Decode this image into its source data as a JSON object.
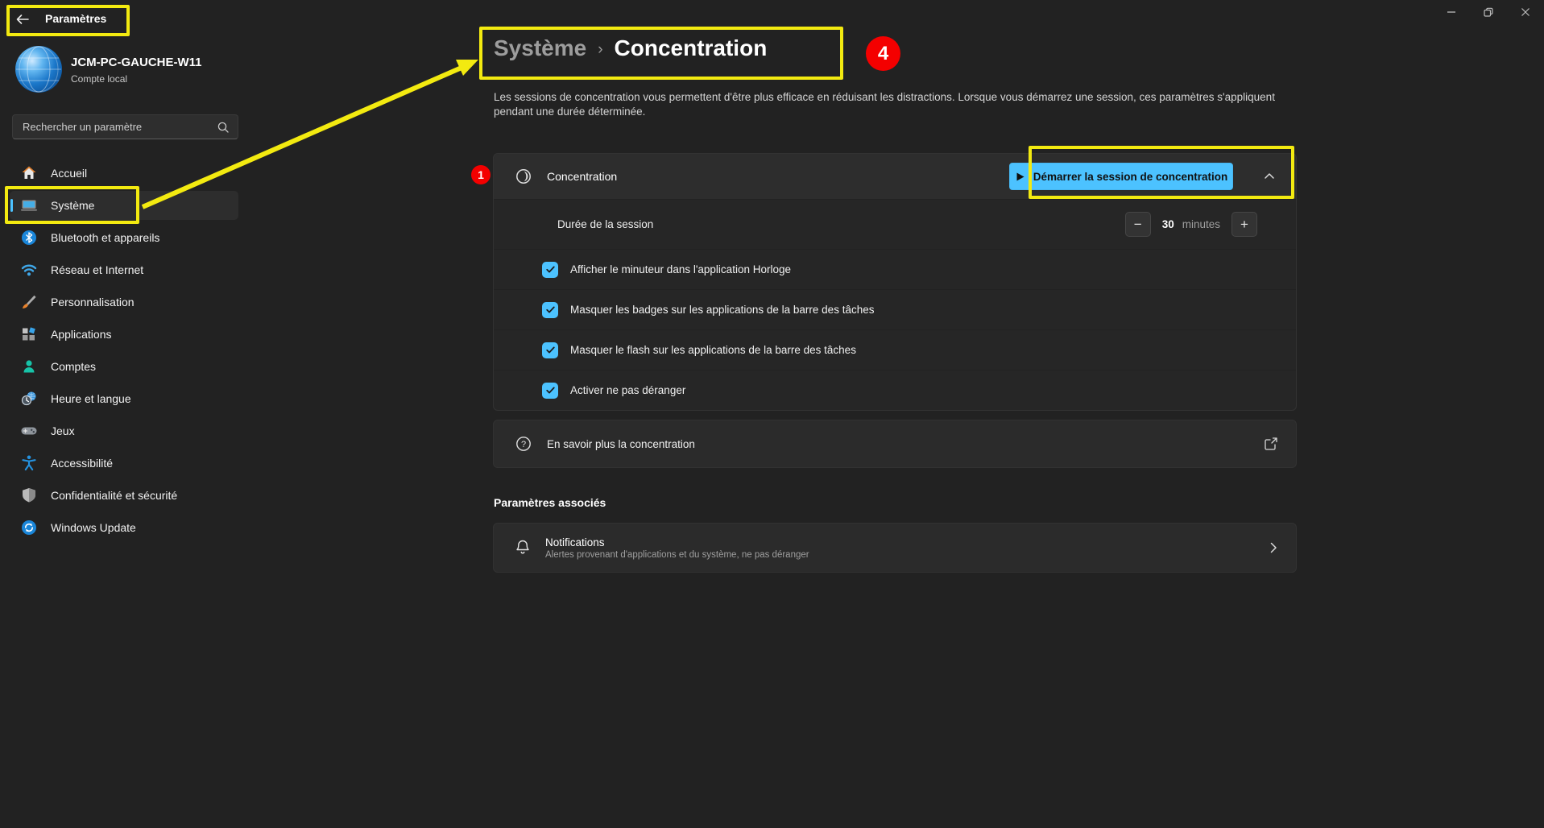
{
  "window": {
    "title": "Paramètres",
    "controls": {
      "minimize": "minimize",
      "restore": "restore",
      "close": "close"
    }
  },
  "account": {
    "name": "JCM-PC-GAUCHE-W11",
    "type": "Compte local"
  },
  "search": {
    "placeholder": "Rechercher un paramètre"
  },
  "sidebar": {
    "items": [
      {
        "label": "Accueil",
        "selected": false
      },
      {
        "label": "Système",
        "selected": true
      },
      {
        "label": "Bluetooth et appareils",
        "selected": false
      },
      {
        "label": "Réseau et Internet",
        "selected": false
      },
      {
        "label": "Personnalisation",
        "selected": false
      },
      {
        "label": "Applications",
        "selected": false
      },
      {
        "label": "Comptes",
        "selected": false
      },
      {
        "label": "Heure et langue",
        "selected": false
      },
      {
        "label": "Jeux",
        "selected": false
      },
      {
        "label": "Accessibilité",
        "selected": false
      },
      {
        "label": "Confidentialité et sécurité",
        "selected": false
      },
      {
        "label": "Windows Update",
        "selected": false
      }
    ]
  },
  "page": {
    "breadcrumb": {
      "parent": "Système",
      "separator": "›",
      "current": "Concentration"
    },
    "description": "Les sessions de concentration vous permettent d'être plus efficace en réduisant les distractions. Lorsque vous démarrez une session, ces paramètres s'appliquent pendant une durée déterminée.",
    "focus_card": {
      "title": "Concentration",
      "start_button": "Démarrer la session de concentration",
      "duration": {
        "label": "Durée de la session",
        "minus": "−",
        "value": "30",
        "unit": "minutes",
        "plus": "+"
      },
      "checkboxes": [
        {
          "label": "Afficher le minuteur dans l'application Horloge",
          "checked": true
        },
        {
          "label": "Masquer les badges sur les applications de la barre des tâches",
          "checked": true
        },
        {
          "label": "Masquer le flash sur les applications de la barre des tâches",
          "checked": true
        },
        {
          "label": "Activer ne pas déranger",
          "checked": true
        }
      ]
    },
    "learn_more": "En savoir plus la concentration",
    "related_heading": "Paramètres associés",
    "notifications": {
      "title": "Notifications",
      "subtitle": "Alertes provenant d'applications et du système, ne pas déranger"
    }
  },
  "annotations": {
    "badge_1": "1",
    "badge_4": "4",
    "highlight_color": "#f3ea10",
    "badge_color": "#f40000"
  },
  "colors": {
    "accent": "#4cc2ff",
    "background": "#222222",
    "card": "#2b2b2b"
  }
}
